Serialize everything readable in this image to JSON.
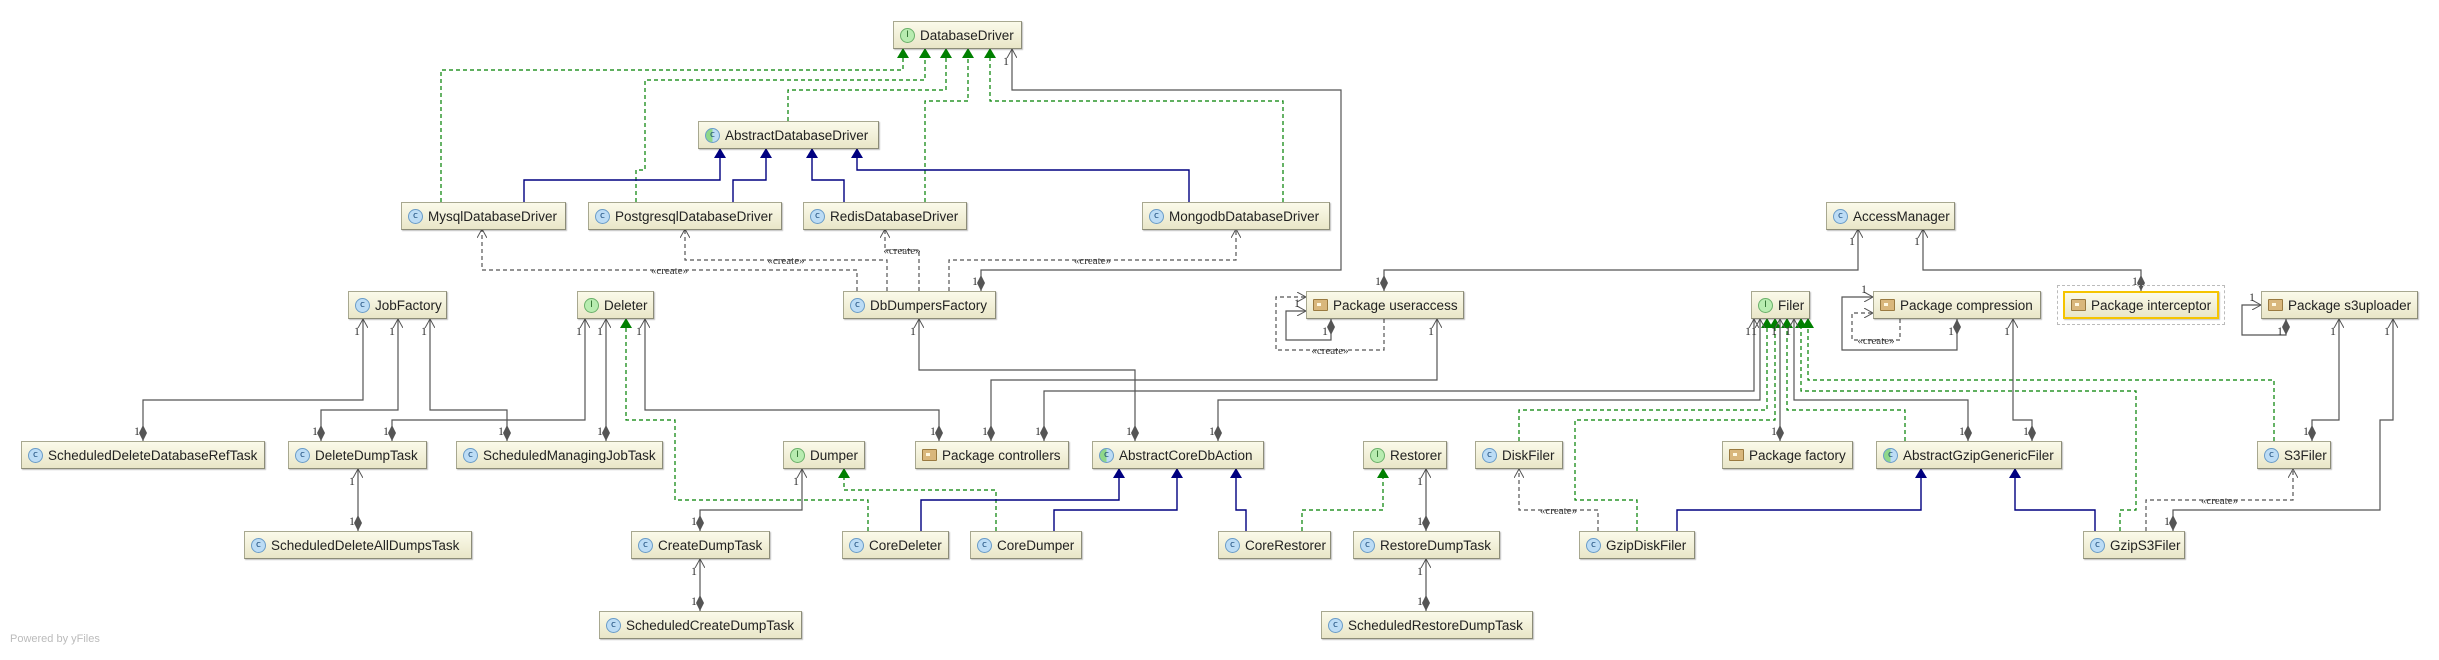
{
  "footer": "Powered by yFiles",
  "colors": {
    "realization": "#008000",
    "generalization": "#000080",
    "association": "#555555",
    "selection": "#f5c400"
  },
  "nodes": [
    {
      "id": "DatabaseDriver",
      "label": "DatabaseDriver",
      "kind": "interface"
    },
    {
      "id": "AbstractDatabaseDriver",
      "label": "AbstractDatabaseDriver",
      "kind": "abstract"
    },
    {
      "id": "MysqlDatabaseDriver",
      "label": "MysqlDatabaseDriver",
      "kind": "class"
    },
    {
      "id": "PostgresqlDatabaseDriver",
      "label": "PostgresqlDatabaseDriver",
      "kind": "class"
    },
    {
      "id": "RedisDatabaseDriver",
      "label": "RedisDatabaseDriver",
      "kind": "class"
    },
    {
      "id": "MongodbDatabaseDriver",
      "label": "MongodbDatabaseDriver",
      "kind": "class"
    },
    {
      "id": "AccessManager",
      "label": "AccessManager",
      "kind": "class"
    },
    {
      "id": "JobFactory",
      "label": "JobFactory",
      "kind": "class"
    },
    {
      "id": "Deleter",
      "label": "Deleter",
      "kind": "interface"
    },
    {
      "id": "DbDumpersFactory",
      "label": "DbDumpersFactory",
      "kind": "class"
    },
    {
      "id": "PackageUseraccess",
      "label": "Package useraccess",
      "kind": "package"
    },
    {
      "id": "Filer",
      "label": "Filer",
      "kind": "interface"
    },
    {
      "id": "PackageCompression",
      "label": "Package compression",
      "kind": "package"
    },
    {
      "id": "PackageInterceptor",
      "label": "Package interceptor",
      "kind": "package",
      "selected": true
    },
    {
      "id": "PackageS3uploader",
      "label": "Package s3uploader",
      "kind": "package"
    },
    {
      "id": "ScheduledDeleteDatabaseRefTask",
      "label": "ScheduledDeleteDatabaseRefTask",
      "kind": "class"
    },
    {
      "id": "DeleteDumpTask",
      "label": "DeleteDumpTask",
      "kind": "class"
    },
    {
      "id": "ScheduledManagingJobTask",
      "label": "ScheduledManagingJobTask",
      "kind": "class"
    },
    {
      "id": "Dumper",
      "label": "Dumper",
      "kind": "interface"
    },
    {
      "id": "PackageControllers",
      "label": "Package controllers",
      "kind": "package"
    },
    {
      "id": "AbstractCoreDbAction",
      "label": "AbstractCoreDbAction",
      "kind": "abstract"
    },
    {
      "id": "Restorer",
      "label": "Restorer",
      "kind": "interface"
    },
    {
      "id": "DiskFiler",
      "label": "DiskFiler",
      "kind": "class"
    },
    {
      "id": "PackageFactory",
      "label": "Package factory",
      "kind": "package"
    },
    {
      "id": "AbstractGzipGenericFiler",
      "label": "AbstractGzipGenericFiler",
      "kind": "abstract"
    },
    {
      "id": "S3Filer",
      "label": "S3Filer",
      "kind": "class"
    },
    {
      "id": "ScheduledDeleteAllDumpsTask",
      "label": "ScheduledDeleteAllDumpsTask",
      "kind": "class"
    },
    {
      "id": "CreateDumpTask",
      "label": "CreateDumpTask",
      "kind": "class"
    },
    {
      "id": "CoreDeleter",
      "label": "CoreDeleter",
      "kind": "class"
    },
    {
      "id": "CoreDumper",
      "label": "CoreDumper",
      "kind": "class"
    },
    {
      "id": "CoreRestorer",
      "label": "CoreRestorer",
      "kind": "class"
    },
    {
      "id": "RestoreDumpTask",
      "label": "RestoreDumpTask",
      "kind": "class"
    },
    {
      "id": "GzipDiskFiler",
      "label": "GzipDiskFiler",
      "kind": "class"
    },
    {
      "id": "GzipS3Filer",
      "label": "GzipS3Filer",
      "kind": "class"
    },
    {
      "id": "ScheduledCreateDumpTask",
      "label": "ScheduledCreateDumpTask",
      "kind": "class"
    },
    {
      "id": "ScheduledRestoreDumpTask",
      "label": "ScheduledRestoreDumpTask",
      "kind": "class"
    }
  ],
  "edges": [
    {
      "from": "MysqlDatabaseDriver",
      "to": "DatabaseDriver",
      "type": "realization"
    },
    {
      "from": "PostgresqlDatabaseDriver",
      "to": "DatabaseDriver",
      "type": "realization"
    },
    {
      "from": "AbstractDatabaseDriver",
      "to": "DatabaseDriver",
      "type": "realization"
    },
    {
      "from": "RedisDatabaseDriver",
      "to": "DatabaseDriver",
      "type": "realization"
    },
    {
      "from": "MongodbDatabaseDriver",
      "to": "DatabaseDriver",
      "type": "realization"
    },
    {
      "from": "CoreDeleter",
      "to": "Deleter",
      "type": "realization"
    },
    {
      "from": "CoreDumper",
      "to": "Dumper",
      "type": "realization"
    },
    {
      "from": "CoreRestorer",
      "to": "Restorer",
      "type": "realization"
    },
    {
      "from": "DiskFiler",
      "to": "Filer",
      "type": "realization"
    },
    {
      "from": "GzipDiskFiler",
      "to": "Filer",
      "type": "realization"
    },
    {
      "from": "AbstractGzipGenericFiler",
      "to": "Filer",
      "type": "realization"
    },
    {
      "from": "GzipS3Filer",
      "to": "Filer",
      "type": "realization"
    },
    {
      "from": "S3Filer",
      "to": "Filer",
      "type": "realization"
    },
    {
      "from": "MysqlDatabaseDriver",
      "to": "AbstractDatabaseDriver",
      "type": "generalization"
    },
    {
      "from": "PostgresqlDatabaseDriver",
      "to": "AbstractDatabaseDriver",
      "type": "generalization"
    },
    {
      "from": "RedisDatabaseDriver",
      "to": "AbstractDatabaseDriver",
      "type": "generalization"
    },
    {
      "from": "MongodbDatabaseDriver",
      "to": "AbstractDatabaseDriver",
      "type": "generalization"
    },
    {
      "from": "CoreDeleter",
      "to": "AbstractCoreDbAction",
      "type": "generalization"
    },
    {
      "from": "CoreDumper",
      "to": "AbstractCoreDbAction",
      "type": "generalization"
    },
    {
      "from": "CoreRestorer",
      "to": "AbstractCoreDbAction",
      "type": "generalization"
    },
    {
      "from": "GzipDiskFiler",
      "to": "AbstractGzipGenericFiler",
      "type": "generalization"
    },
    {
      "from": "GzipS3Filer",
      "to": "AbstractGzipGenericFiler",
      "type": "generalization"
    },
    {
      "from": "DbDumpersFactory",
      "to": "MysqlDatabaseDriver",
      "type": "create",
      "label": "«create»"
    },
    {
      "from": "DbDumpersFactory",
      "to": "PostgresqlDatabaseDriver",
      "type": "create",
      "label": "«create»"
    },
    {
      "from": "DbDumpersFactory",
      "to": "RedisDatabaseDriver",
      "type": "create",
      "label": "«create»"
    },
    {
      "from": "DbDumpersFactory",
      "to": "MongodbDatabaseDriver",
      "type": "create",
      "label": "«create»"
    },
    {
      "from": "GzipDiskFiler",
      "to": "DiskFiler",
      "type": "create",
      "label": "«create»"
    },
    {
      "from": "GzipS3Filer",
      "to": "S3Filer",
      "type": "create",
      "label": "«create»"
    },
    {
      "from": "PackageUseraccess",
      "to": "PackageUseraccess",
      "type": "create",
      "label": "«create»"
    },
    {
      "from": "PackageCompression",
      "to": "PackageCompression",
      "type": "create",
      "label": "«create»"
    },
    {
      "from": "ScheduledDeleteDatabaseRefTask",
      "to": "JobFactory",
      "type": "composition",
      "multiplicity": [
        "1",
        "1"
      ]
    },
    {
      "from": "DeleteDumpTask",
      "to": "JobFactory",
      "type": "composition",
      "multiplicity": [
        "1",
        "1"
      ]
    },
    {
      "from": "ScheduledManagingJobTask",
      "to": "JobFactory",
      "type": "composition",
      "multiplicity": [
        "1",
        "1"
      ]
    },
    {
      "from": "DeleteDumpTask",
      "to": "Deleter",
      "type": "composition",
      "multiplicity": [
        "1",
        "1"
      ]
    },
    {
      "from": "ScheduledManagingJobTask",
      "to": "Deleter",
      "type": "composition",
      "multiplicity": [
        "1",
        "1"
      ]
    },
    {
      "from": "PackageControllers",
      "to": "Deleter",
      "type": "composition",
      "multiplicity": [
        "1",
        "1"
      ]
    },
    {
      "from": "ScheduledDeleteAllDumpsTask",
      "to": "DeleteDumpTask",
      "type": "composition",
      "multiplicity": [
        "1",
        "1"
      ]
    },
    {
      "from": "CreateDumpTask",
      "to": "Dumper",
      "type": "composition",
      "multiplicity": [
        "1",
        "1"
      ]
    },
    {
      "from": "ScheduledCreateDumpTask",
      "to": "CreateDumpTask",
      "type": "composition",
      "multiplicity": [
        "1",
        "1"
      ]
    },
    {
      "from": "AbstractCoreDbAction",
      "to": "DbDumpersFactory",
      "type": "composition",
      "multiplicity": [
        "1",
        "1"
      ]
    },
    {
      "from": "PackageControllers",
      "to": "PackageUseraccess",
      "type": "composition",
      "multiplicity": [
        "1",
        "1"
      ]
    },
    {
      "from": "PackageControllers",
      "to": "Filer",
      "type": "composition",
      "multiplicity": [
        "1",
        "1"
      ]
    },
    {
      "from": "AbstractCoreDbAction",
      "to": "Filer",
      "type": "composition",
      "multiplicity": [
        "1",
        "1"
      ]
    },
    {
      "from": "DbDumpersFactory",
      "to": "DatabaseDriver",
      "type": "composition",
      "multiplicity": [
        "1",
        "1"
      ]
    },
    {
      "from": "RestoreDumpTask",
      "to": "Restorer",
      "type": "composition",
      "multiplicity": [
        "1",
        "1"
      ]
    },
    {
      "from": "ScheduledRestoreDumpTask",
      "to": "RestoreDumpTask",
      "type": "composition",
      "multiplicity": [
        "1",
        "1"
      ]
    },
    {
      "from": "PackageUseraccess",
      "to": "AccessManager",
      "type": "composition",
      "multiplicity": [
        "1",
        "1"
      ]
    },
    {
      "from": "PackageInterceptor",
      "to": "AccessManager",
      "type": "composition",
      "multiplicity": [
        "1",
        "1"
      ]
    },
    {
      "from": "PackageFactory",
      "to": "Filer",
      "type": "composition",
      "multiplicity": [
        "1",
        "1"
      ]
    },
    {
      "from": "AbstractGzipGenericFiler",
      "to": "Filer",
      "type": "composition",
      "multiplicity": [
        "1",
        "1"
      ]
    },
    {
      "from": "AbstractGzipGenericFiler",
      "to": "PackageCompression",
      "type": "composition",
      "multiplicity": [
        "1",
        "1"
      ]
    },
    {
      "from": "S3Filer",
      "to": "PackageS3uploader",
      "type": "composition",
      "multiplicity": [
        "1",
        "1"
      ]
    },
    {
      "from": "GzipS3Filer",
      "to": "PackageS3uploader",
      "type": "composition",
      "multiplicity": [
        "1",
        "1"
      ]
    },
    {
      "from": "PackageS3uploader",
      "to": "PackageS3uploader",
      "type": "composition",
      "multiplicity": [
        "1",
        "1"
      ]
    },
    {
      "from": "PackageUseraccess",
      "to": "PackageUseraccess",
      "type": "composition",
      "multiplicity": [
        "1",
        "1"
      ]
    },
    {
      "from": "PackageCompression",
      "to": "PackageCompression",
      "type": "composition",
      "multiplicity": [
        "1",
        "1"
      ]
    }
  ]
}
